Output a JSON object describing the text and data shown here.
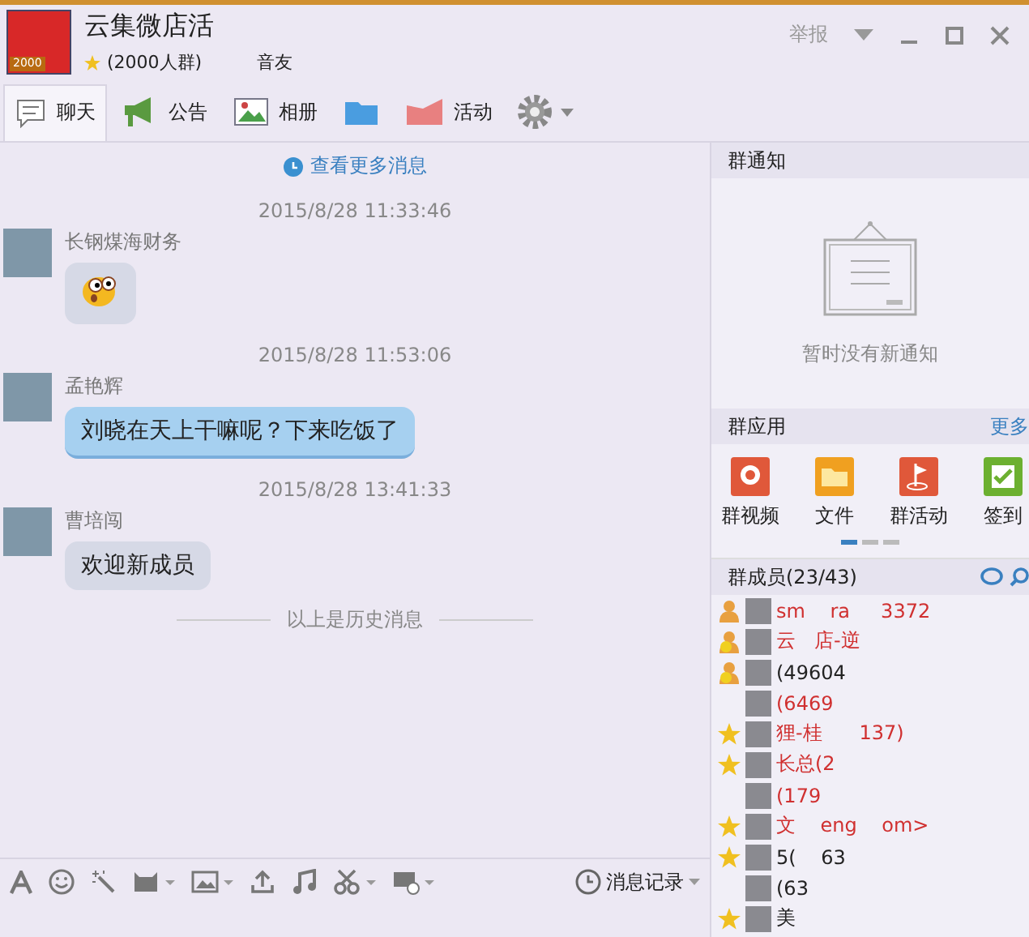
{
  "header": {
    "title": "云集微店活",
    "badge": "2000",
    "subtitle": "(2000人群)",
    "subtitle_tail": "音友",
    "report": "举报"
  },
  "tabs": [
    {
      "label": "聊天",
      "selected": true
    },
    {
      "label": "公告",
      "selected": false
    },
    {
      "label": "相册",
      "selected": false
    },
    {
      "selected": false
    },
    {
      "label": "活动",
      "selected": false
    }
  ],
  "chat": {
    "more_link": "查看更多消息",
    "history_note": "以上是历史消息",
    "messages": [
      {
        "time": "2015/8/28 11:33:46",
        "sender": "长钢煤海财务",
        "kind": "emoji"
      },
      {
        "time": "2015/8/28 11:53:06",
        "sender": "孟艳辉",
        "kind": "themed",
        "text": "刘晓在天上干嘛呢？下来吃饭了"
      },
      {
        "time": "2015/8/28 13:41:33",
        "sender": "曹培闯",
        "kind": "text",
        "text": "欢迎新成员"
      }
    ]
  },
  "toolbar": {
    "history": "消息记录"
  },
  "notice": {
    "title": "群通知",
    "empty": "暂时没有新通知"
  },
  "apps": {
    "title": "群应用",
    "more": "更多",
    "items": [
      {
        "label": "群视频",
        "color": "#e0583a"
      },
      {
        "label": "文件",
        "color": "#f0a020"
      },
      {
        "label": "群活动",
        "color": "#e0583a"
      },
      {
        "label": "签到",
        "color": "#6cb030"
      }
    ],
    "pages": [
      {
        "selected": true
      },
      {
        "selected": false
      },
      {
        "selected": false
      }
    ]
  },
  "members": {
    "title": "群成员(23/43)",
    "items": [
      {
        "kind": "owner",
        "text": "sm    ra     3372",
        "vip": true
      },
      {
        "kind": "admin",
        "text": "云   店-逆",
        "vip": true
      },
      {
        "kind": "admin",
        "text": "(49604",
        "vip": false
      },
      {
        "kind": "plain",
        "text": "(6469",
        "vip": true
      },
      {
        "kind": "star",
        "text": "狸-桂      137)",
        "vip": true
      },
      {
        "kind": "star",
        "text": "长总(2",
        "vip": true
      },
      {
        "kind": "plain",
        "text": "(179",
        "vip": true
      },
      {
        "kind": "star",
        "text": "文    eng    om>",
        "vip": true
      },
      {
        "kind": "star",
        "text": "5(    63",
        "vip": false
      },
      {
        "kind": "plain",
        "text": "(63",
        "vip": false
      },
      {
        "kind": "star",
        "text": "美",
        "vip": false
      }
    ]
  }
}
